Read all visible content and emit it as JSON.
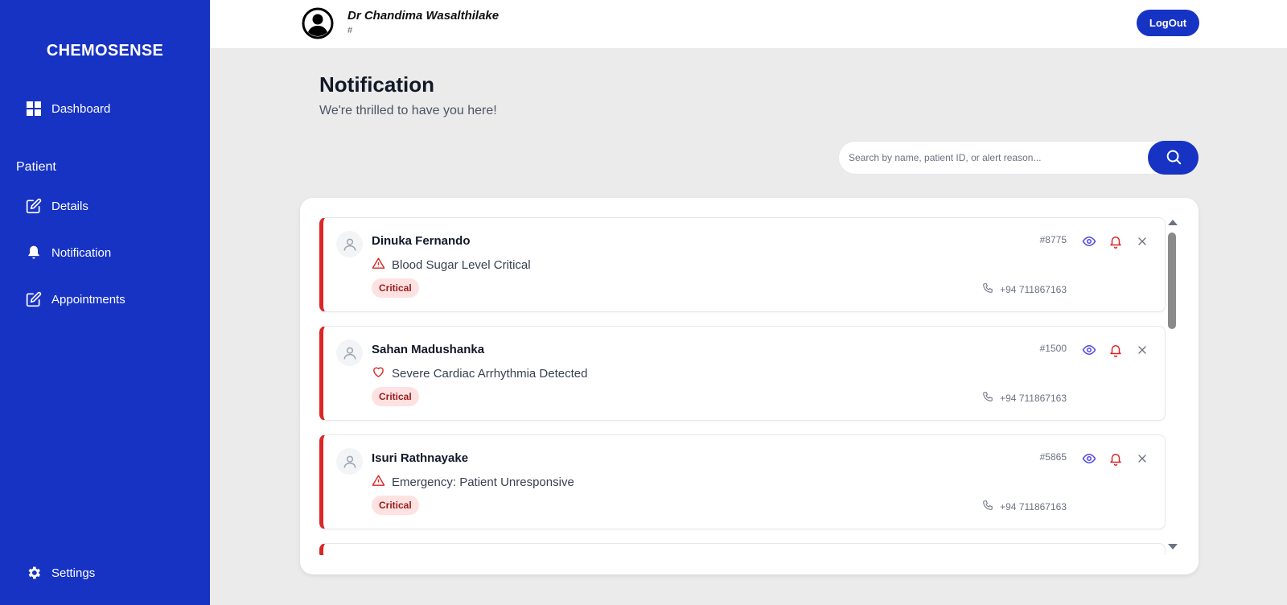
{
  "sidebar": {
    "brand": "CHEMOSENSE",
    "items": [
      {
        "label": "Dashboard",
        "icon": "grid-icon"
      },
      {
        "label": "Details",
        "icon": "edit-icon"
      },
      {
        "label": "Notification",
        "icon": "bell-icon"
      },
      {
        "label": "Appointments",
        "icon": "edit-icon"
      },
      {
        "label": "Settings",
        "icon": "gear-icon"
      }
    ],
    "section_label": "Patient"
  },
  "header": {
    "doctor_name": "Dr Chandima Wasalthilake",
    "doctor_sub": "#",
    "logout_label": "LogOut"
  },
  "page": {
    "title": "Notification",
    "subtitle": "We're thrilled to have you here!"
  },
  "search": {
    "placeholder": "Search by name, patient ID, or alert reason...",
    "value": ""
  },
  "notifications": [
    {
      "name": "Dinuka Fernando",
      "id": "#8775",
      "reason": "Blood Sugar Level Critical",
      "reason_icon": "alert-triangle-icon",
      "badge": "Critical",
      "phone": "+94 711867163"
    },
    {
      "name": "Sahan Madushanka",
      "id": "#1500",
      "reason": "Severe Cardiac Arrhythmia Detected",
      "reason_icon": "heart-icon",
      "badge": "Critical",
      "phone": "+94 711867163"
    },
    {
      "name": "Isuri Rathnayake",
      "id": "#5865",
      "reason": "Emergency: Patient Unresponsive",
      "reason_icon": "alert-triangle-icon",
      "badge": "Critical",
      "phone": "+94 711867163"
    }
  ],
  "colors": {
    "sidebar_bg": "#1733c4",
    "accent": "#1733c4",
    "critical": "#dc2626",
    "badge_bg": "#fee2e2",
    "view_icon": "#4f46e5",
    "page_bg": "#ebebeb"
  }
}
